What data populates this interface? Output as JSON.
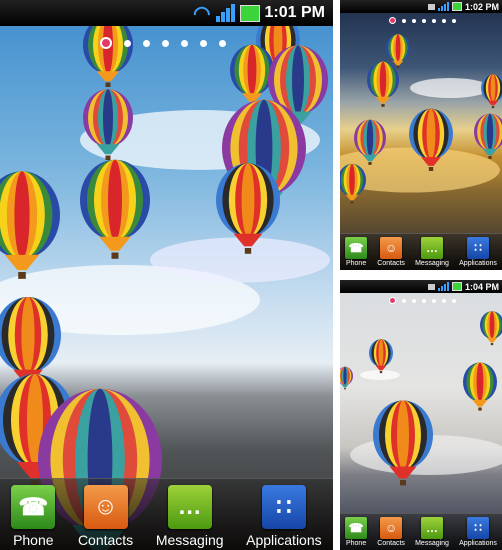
{
  "screens": [
    {
      "time": "1:01 PM",
      "pages": 7,
      "active_page": 0
    },
    {
      "time": "1:02 PM",
      "pages": 7,
      "active_page": 0
    },
    {
      "time": "1:04 PM",
      "pages": 7,
      "active_page": 0
    }
  ],
  "dock": {
    "phone": "Phone",
    "contacts": "Contacts",
    "messaging": "Messaging",
    "applications": "Applications"
  },
  "icons": {
    "wifi": "wifi-icon",
    "signal": "signal-icon",
    "battery": "battery-icon",
    "sim": "sim-icon"
  },
  "colors": {
    "active_dot": "#e23a6a",
    "signal": "#3aa0ff",
    "battery": "#3bd43b"
  }
}
